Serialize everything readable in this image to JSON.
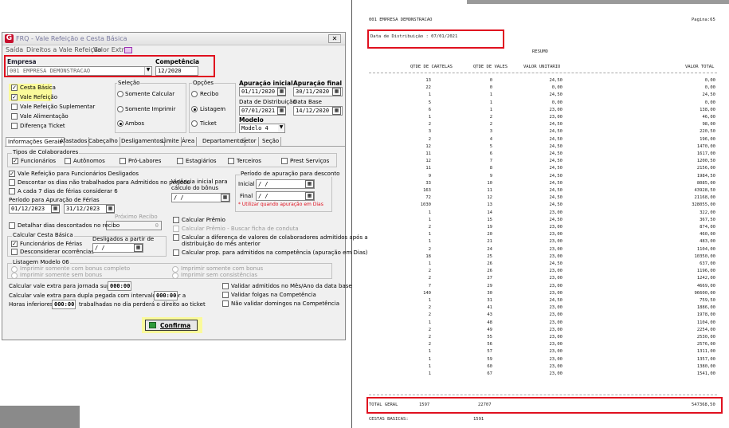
{
  "window": {
    "title": "FRQ - Vale Refeição e Cesta Básica",
    "close": "✕",
    "menu": [
      "Saída",
      "Direitos a Vale Refeição",
      "Valor Extra"
    ]
  },
  "empresa": {
    "label": "Empresa",
    "value": "001 EMPRESA DEMONSTRACAO"
  },
  "competencia": {
    "label": "Competência",
    "value": "12/2020"
  },
  "tipos": [
    {
      "label": "Cesta Básica",
      "checked": true
    },
    {
      "label": "Vale Refeição",
      "checked": true
    },
    {
      "label": "Vale Refeição Suplementar",
      "checked": false
    },
    {
      "label": "Vale Alimentação",
      "checked": false
    },
    {
      "label": "Diferença Ticket",
      "checked": false
    }
  ],
  "selecao": {
    "title": "Seleção",
    "options": [
      "Somente Calcular",
      "Somente Imprimir",
      "Ambos"
    ],
    "selected": 2
  },
  "opcoes": {
    "title": "Opções",
    "options": [
      "Recibo",
      "Listagem",
      "Ticket"
    ],
    "selected": 1
  },
  "apuracao_inicial": {
    "label": "Apuração inicial",
    "value": "01/11/2020"
  },
  "apuracao_final": {
    "label": "Apuração final",
    "value": "30/11/2020"
  },
  "data_distribuicao": {
    "label": "Data de Distribuição",
    "value": "07/01/2021"
  },
  "data_base": {
    "label": "Data Base",
    "value": "14/12/2020"
  },
  "modelo": {
    "label": "Modelo",
    "value": "Modelo 4"
  },
  "tabs": [
    "Informações Gerais",
    "Afastados",
    "Cabeçalho",
    "Desligamentos",
    "Limite",
    "Área",
    "Departamento",
    "Setor",
    "Seção"
  ],
  "tipos_colab": {
    "title": "Tipos de Colaboradores",
    "items": [
      {
        "label": "Funcionários",
        "checked": true
      },
      {
        "label": "Autônomos",
        "checked": false
      },
      {
        "label": "Pró-Labores",
        "checked": false
      },
      {
        "label": "Estagiários",
        "checked": false
      },
      {
        "label": "Terceiros",
        "checked": false
      },
      {
        "label": "Prest Serviços",
        "checked": false
      }
    ]
  },
  "opts_left": [
    {
      "label": "Vale Refeição para Funcionários Desligados",
      "checked": true
    },
    {
      "label": "Descontar os dias não trabalhados para Admitidos no período",
      "checked": false
    },
    {
      "label": "A cada 7 dias de férias considerar 6",
      "checked": false
    }
  ],
  "periodo_ferias": {
    "label": "Período para Apuração de Férias",
    "from": "01/12/2023",
    "to": "31/12/2023"
  },
  "proximo_recibo": {
    "label": "Próximo Recibo",
    "value": "0"
  },
  "detalhar": {
    "label": "Detalhar dias descontados no recibo",
    "checked": false
  },
  "cesta": {
    "title": "Calcular Cesta Básica",
    "func": "Funcionários de Férias",
    "desc": "Desconsiderar ocorrências",
    "deslig_label": "Desligados a partir de",
    "deslig_value": "/ /"
  },
  "listagem06": {
    "title": "Listagem Modelo 06",
    "items": [
      "Imprimir somente com bonus completo",
      "Imprimir somente sem bonus",
      "Imprimir somente com bonus",
      "Imprimir sem consistências"
    ]
  },
  "vigencia": {
    "label1": "Vigência inicial para",
    "label2": "cálculo do bônus",
    "value": "/ /"
  },
  "periodo_desc": {
    "title": "Período de apuração para desconto",
    "inicial": "Inicial",
    "final": "Final",
    "inicial_value": "/ /",
    "final_value": "/ /",
    "note": "* Utilizar quando apuração em Dias"
  },
  "opts_right": [
    {
      "label": "Calcular Prêmio",
      "gray": false
    },
    {
      "label": "Calcular Prêmio - Buscar ficha de conduta",
      "gray": true
    },
    {
      "label": "Calcular a diferença de valores de colaboradores admitidos após a",
      "gray": false
    },
    {
      "label": "distribuição do mês anterior",
      "gray": false
    },
    {
      "label": "Calcular prop. para admitidos na competência (apuração em Dias)",
      "gray": false
    }
  ],
  "extras": {
    "jornada_label": "Calcular vale extra para jornada superior a",
    "jornada_value": "000:00",
    "dupla_label": "Calcular vale extra para dupla pegada com intervalo superior a",
    "dupla_value": "000:00",
    "horas_label": "Horas inferiores a",
    "horas_value": "000:00",
    "horas_suffix": "trabalhadas no dia perderá o direito ao ticket"
  },
  "validar": [
    "Validar admitidos no Mês/Ano da data base",
    "Validar folgas na Competência",
    "Não validar domingos na Competência"
  ],
  "confirm": "Confirma",
  "report": {
    "empresa": "001 EMPRESA DEMONSTRACAO",
    "pagina": "Pagina:65",
    "data_dist": "Data de Distribuição : 07/01/2021",
    "resumo": "RESUMO",
    "headers": [
      "QTDE DE CARTELAS",
      "QTDE DE VALES",
      "VALOR UNITARIO",
      "VALOR TOTAL"
    ],
    "rows": [
      [
        "13",
        "0",
        "24,50",
        "0,00"
      ],
      [
        "22",
        "0",
        "0,00",
        "0,00"
      ],
      [
        "1",
        "1",
        "24,50",
        "24,50"
      ],
      [
        "5",
        "1",
        "0,00",
        "0,00"
      ],
      [
        "6",
        "1",
        "23,00",
        "138,00"
      ],
      [
        "1",
        "2",
        "23,00",
        "46,00"
      ],
      [
        "2",
        "2",
        "24,50",
        "98,00"
      ],
      [
        "3",
        "3",
        "24,50",
        "220,50"
      ],
      [
        "2",
        "4",
        "24,50",
        "196,00"
      ],
      [
        "12",
        "5",
        "24,50",
        "1470,00"
      ],
      [
        "11",
        "6",
        "24,50",
        "1617,00"
      ],
      [
        "12",
        "7",
        "24,50",
        "1200,50"
      ],
      [
        "11",
        "8",
        "24,50",
        "2156,00"
      ],
      [
        "9",
        "9",
        "24,50",
        "1984,50"
      ],
      [
        "33",
        "10",
        "24,50",
        "8085,00"
      ],
      [
        "163",
        "11",
        "24,50",
        "43928,50"
      ],
      [
        "72",
        "12",
        "24,50",
        "21168,00"
      ],
      [
        "1030",
        "13",
        "24,50",
        "328055,00"
      ],
      [
        "1",
        "14",
        "23,00",
        "322,00"
      ],
      [
        "1",
        "15",
        "24,50",
        "367,50"
      ],
      [
        "2",
        "19",
        "23,00",
        "874,00"
      ],
      [
        "1",
        "20",
        "23,00",
        "460,00"
      ],
      [
        "1",
        "21",
        "23,00",
        "483,00"
      ],
      [
        "2",
        "24",
        "23,00",
        "1104,00"
      ],
      [
        "18",
        "25",
        "23,00",
        "10350,00"
      ],
      [
        "1",
        "26",
        "24,50",
        "637,00"
      ],
      [
        "2",
        "26",
        "23,00",
        "1196,00"
      ],
      [
        "2",
        "27",
        "23,00",
        "1242,00"
      ],
      [
        "7",
        "29",
        "23,00",
        "4669,00"
      ],
      [
        "140",
        "30",
        "23,00",
        "96600,00"
      ],
      [
        "1",
        "31",
        "24,50",
        "759,50"
      ],
      [
        "2",
        "41",
        "23,00",
        "1886,00"
      ],
      [
        "2",
        "43",
        "23,00",
        "1978,00"
      ],
      [
        "1",
        "48",
        "23,00",
        "1104,00"
      ],
      [
        "2",
        "49",
        "23,00",
        "2254,00"
      ],
      [
        "2",
        "55",
        "23,00",
        "2530,00"
      ],
      [
        "2",
        "56",
        "23,00",
        "2576,00"
      ],
      [
        "1",
        "57",
        "23,00",
        "1311,00"
      ],
      [
        "1",
        "59",
        "23,00",
        "1357,00"
      ],
      [
        "1",
        "60",
        "23,00",
        "1380,00"
      ],
      [
        "1",
        "67",
        "23,00",
        "1541,00"
      ]
    ],
    "total_label": "TOTAL GERAL",
    "total_cartelas": "1597",
    "total_vales": "22707",
    "total_valor": "547368,50",
    "cestas_label": "CESTAS BASICAS:",
    "cestas_value": "1591"
  }
}
